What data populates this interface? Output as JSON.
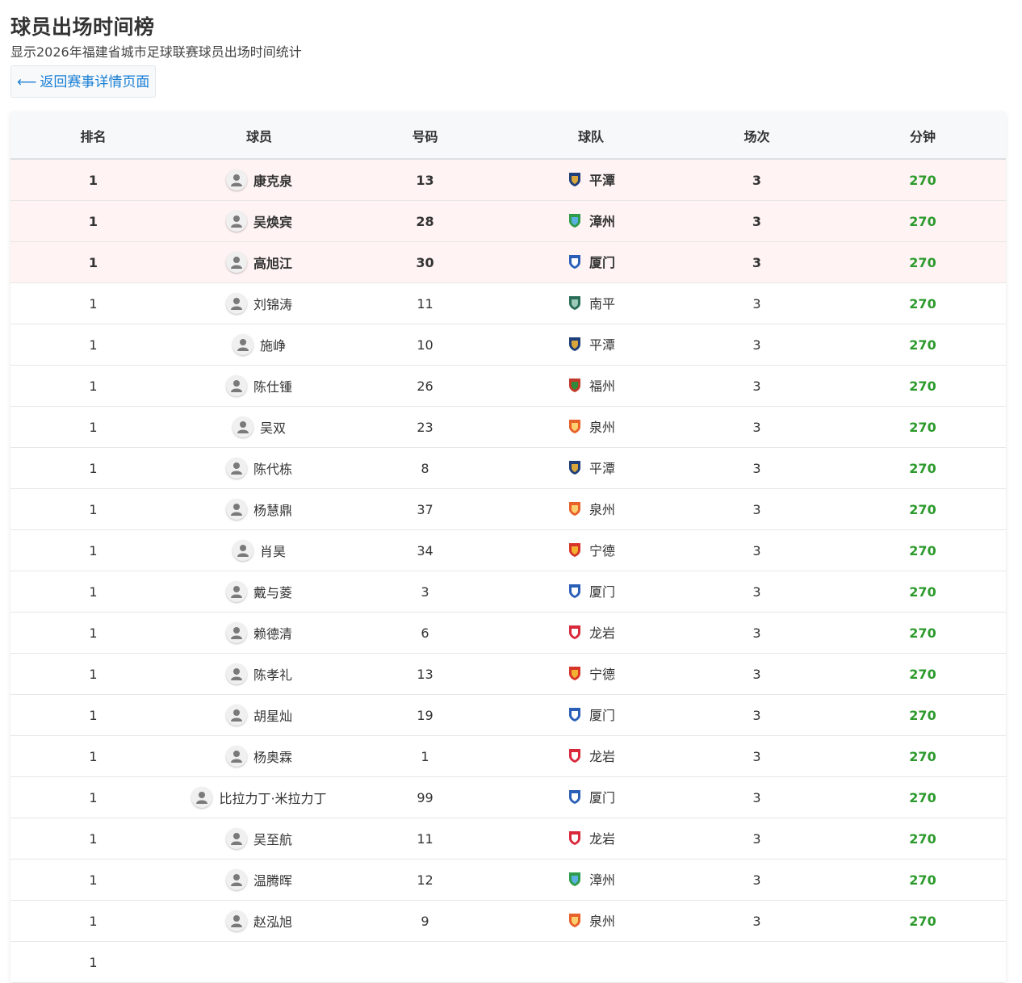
{
  "page": {
    "title": "球员出场时间榜",
    "subtitle": "显示2026年福建省城市足球联赛球员出场时间统计",
    "back_label": "返回赛事详情页面",
    "back_arrow": "⟵"
  },
  "table": {
    "headers": [
      "排名",
      "球员",
      "号码",
      "球队",
      "场次",
      "分钟"
    ],
    "accent_minutes_color": "#2c9a2c",
    "highlight_row_color": "#fff3f3",
    "rows": [
      {
        "rank": "1",
        "player": "康克泉",
        "number": "13",
        "team": "平潭",
        "team_logo": "pingtan-logo",
        "matches": "3",
        "minutes": "270",
        "highlight": true
      },
      {
        "rank": "1",
        "player": "吴焕宾",
        "number": "28",
        "team": "漳州",
        "team_logo": "zhangzhou-logo",
        "matches": "3",
        "minutes": "270",
        "highlight": true
      },
      {
        "rank": "1",
        "player": "高旭江",
        "number": "30",
        "team": "厦门",
        "team_logo": "xiamen-logo",
        "matches": "3",
        "minutes": "270",
        "highlight": true
      },
      {
        "rank": "1",
        "player": "刘锦涛",
        "number": "11",
        "team": "南平",
        "team_logo": "nanping-logo",
        "matches": "3",
        "minutes": "270",
        "highlight": false
      },
      {
        "rank": "1",
        "player": "施峥",
        "number": "10",
        "team": "平潭",
        "team_logo": "pingtan-logo",
        "matches": "3",
        "minutes": "270",
        "highlight": false
      },
      {
        "rank": "1",
        "player": "陈仕锺",
        "number": "26",
        "team": "福州",
        "team_logo": "fuzhou-logo",
        "matches": "3",
        "minutes": "270",
        "highlight": false
      },
      {
        "rank": "1",
        "player": "吴双",
        "number": "23",
        "team": "泉州",
        "team_logo": "quanzhou-logo",
        "matches": "3",
        "minutes": "270",
        "highlight": false
      },
      {
        "rank": "1",
        "player": "陈代栋",
        "number": "8",
        "team": "平潭",
        "team_logo": "pingtan-logo",
        "matches": "3",
        "minutes": "270",
        "highlight": false
      },
      {
        "rank": "1",
        "player": "杨慧鼎",
        "number": "37",
        "team": "泉州",
        "team_logo": "quanzhou-logo",
        "matches": "3",
        "minutes": "270",
        "highlight": false
      },
      {
        "rank": "1",
        "player": "肖昊",
        "number": "34",
        "team": "宁德",
        "team_logo": "ningde-logo",
        "matches": "3",
        "minutes": "270",
        "highlight": false
      },
      {
        "rank": "1",
        "player": "戴与菱",
        "number": "3",
        "team": "厦门",
        "team_logo": "xiamen-logo",
        "matches": "3",
        "minutes": "270",
        "highlight": false
      },
      {
        "rank": "1",
        "player": "赖德清",
        "number": "6",
        "team": "龙岩",
        "team_logo": "longyan-logo",
        "matches": "3",
        "minutes": "270",
        "highlight": false
      },
      {
        "rank": "1",
        "player": "陈孝礼",
        "number": "13",
        "team": "宁德",
        "team_logo": "ningde-logo",
        "matches": "3",
        "minutes": "270",
        "highlight": false
      },
      {
        "rank": "1",
        "player": "胡星灿",
        "number": "19",
        "team": "厦门",
        "team_logo": "xiamen-logo",
        "matches": "3",
        "minutes": "270",
        "highlight": false
      },
      {
        "rank": "1",
        "player": "杨奥霖",
        "number": "1",
        "team": "龙岩",
        "team_logo": "longyan-logo",
        "matches": "3",
        "minutes": "270",
        "highlight": false
      },
      {
        "rank": "1",
        "player": "比拉力丁·米拉力丁",
        "number": "99",
        "team": "厦门",
        "team_logo": "xiamen-logo",
        "matches": "3",
        "minutes": "270",
        "highlight": false
      },
      {
        "rank": "1",
        "player": "吴至航",
        "number": "11",
        "team": "龙岩",
        "team_logo": "longyan-logo",
        "matches": "3",
        "minutes": "270",
        "highlight": false
      },
      {
        "rank": "1",
        "player": "温腾晖",
        "number": "12",
        "team": "漳州",
        "team_logo": "zhangzhou-logo",
        "matches": "3",
        "minutes": "270",
        "highlight": false
      },
      {
        "rank": "1",
        "player": "赵泓旭",
        "number": "9",
        "team": "泉州",
        "team_logo": "quanzhou-logo",
        "matches": "3",
        "minutes": "270",
        "highlight": false
      },
      {
        "rank": "1",
        "player": "",
        "number": "",
        "team": "",
        "team_logo": "",
        "matches": "",
        "minutes": "",
        "highlight": false
      }
    ]
  },
  "team_logo_colors": {
    "pingtan-logo": [
      "#1f3f7a",
      "#d8a63a"
    ],
    "zhangzhou-logo": [
      "#2e9c4a",
      "#5ab0e0"
    ],
    "xiamen-logo": [
      "#2a5fb8",
      "#ffffff"
    ],
    "nanping-logo": [
      "#2a6e5a",
      "#9cc9b8"
    ],
    "fuzhou-logo": [
      "#c23a2a",
      "#2e8b3a"
    ],
    "quanzhou-logo": [
      "#e8602a",
      "#ffd070"
    ],
    "ningde-logo": [
      "#d8352a",
      "#f2b230"
    ],
    "longyan-logo": [
      "#d8283a",
      "#ffffff"
    ]
  }
}
